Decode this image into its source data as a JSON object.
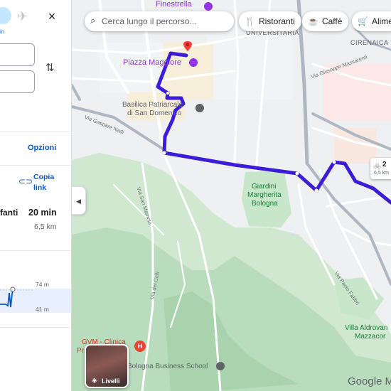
{
  "panel": {
    "mode_bike_label": "in",
    "close_icon": "×",
    "swap_icon": "⇅",
    "options_label": "Opzioni",
    "copy_link_label": "Copia link",
    "route_name": "fanti",
    "route_duration": "20 min",
    "route_distance": "6,5 km",
    "elevation_max": "74 m",
    "elevation_min": "41 m"
  },
  "map": {
    "search_placeholder": "Cerca lungo il percorso...",
    "chips": [
      {
        "icon": "restaurant-icon",
        "glyph": "🍴",
        "label": "Ristoranti"
      },
      {
        "icon": "coffee-icon",
        "glyph": "☕",
        "label": "Caffè"
      },
      {
        "icon": "cart-icon",
        "glyph": "🛒",
        "label": "Alime"
      }
    ],
    "labels": {
      "finestrella": "Finestrella",
      "universitaria": "UNIVERSITARIA",
      "cirenaica": "CIRENAICA",
      "piazza_maggiore": "Piazza Maggiore",
      "basilica": "Basilica Patriarcale",
      "basilica2": "di San Domenico",
      "giardini1": "Giardini",
      "giardini2": "Margherita",
      "giardini3": "Bologna",
      "villa1": "Villa Aldrovan",
      "villa2": "Mazzacor",
      "clinica1": "GVM - Clinica",
      "clinica2": "Pr",
      "business_school": "Bologna Business School",
      "street1": "Via San Mamolo",
      "street2": "Via del Colli",
      "street3": "Via Giuseppe Massarenti",
      "street4": "Via Paolo Fabbri",
      "street5": "Via Gaspare Nadi"
    },
    "route_tip": {
      "icon": "bike-icon",
      "time": "2",
      "distance": "6,5 km"
    },
    "layers_label": "Livelli",
    "google": "Google M",
    "collapse_icon": "◀",
    "colors": {
      "route": "#3c1cd9",
      "park": "#c8e6c9",
      "road": "#ffffff",
      "highway": "#a8c7fa",
      "accent": "#0b57d0"
    }
  }
}
